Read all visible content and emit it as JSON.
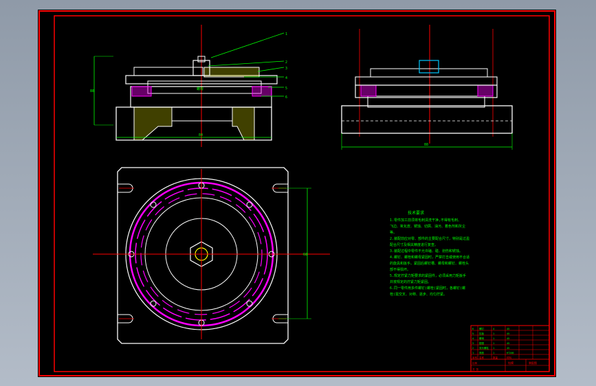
{
  "colors": {
    "background": "#000000",
    "frame": "#ff0000",
    "outline": "#ffffff",
    "dimension": "#00ff00",
    "magenta": "#ff00ff",
    "center_line": "#ff0000",
    "hatch": "#ffff00",
    "cyan": "#00c8ff",
    "title_block": "#ff0000"
  },
  "drawing": {
    "front_view": {
      "part_callouts": [
        "1",
        "2",
        "3",
        "4",
        "5",
        "6"
      ],
      "inner_label": "螺母",
      "height_dim": "88",
      "width_dim": "84"
    },
    "side_view": {
      "width_dim": "88"
    },
    "plan_view": {
      "height_dim": "68"
    },
    "technical_requirements": {
      "title": "技术要求",
      "lines": [
        "1.零件加工前须将毛刺清洗干净,不得有毛刺、",
        "飞边、氧化皮、锈蚀、切屑、油污、着色剂和灰尘",
        "等。",
        "2.装配前应对零、部件的主要配合尺寸，特别是过盈",
        "配合尺寸及相关精度进行复查。",
        "3.装配过程中零件不允许磕、碰、划伤和锈蚀。",
        "4.螺钉、螺栓和螺母紧固时，严禁打击或使用不合适",
        "的旋具和扳手。紧固后螺钉槽、螺母和螺钉、螺栓头",
        "部不得损坏。",
        "5.规定拧紧力矩要求的紧固件，必须采用力矩扳手",
        "并按规定的拧紧力矩紧固。",
        "6.同一零件用多件螺钉(螺栓)紧固时，各螺钉(螺",
        "栓)需交叉、对称、逐步、均匀拧紧。"
      ]
    },
    "title_block": {
      "bom_rows": [
        [
          "6",
          "螺钉",
          "4",
          "45"
        ],
        [
          "5",
          "压板",
          "1",
          "45"
        ],
        [
          "4",
          "螺母",
          "1",
          "45"
        ],
        [
          "3",
          "垫圈",
          "1",
          "45"
        ],
        [
          "2",
          "双头螺柱",
          "1",
          "45"
        ],
        [
          "1",
          "底座",
          "1",
          "HT200"
        ]
      ],
      "header": [
        "序号",
        "名称",
        "数量",
        "材料"
      ],
      "drawing_name": "钻模",
      "drawing_code": "装配图",
      "scale_label": "比例",
      "sheet_label": "共 张"
    }
  }
}
